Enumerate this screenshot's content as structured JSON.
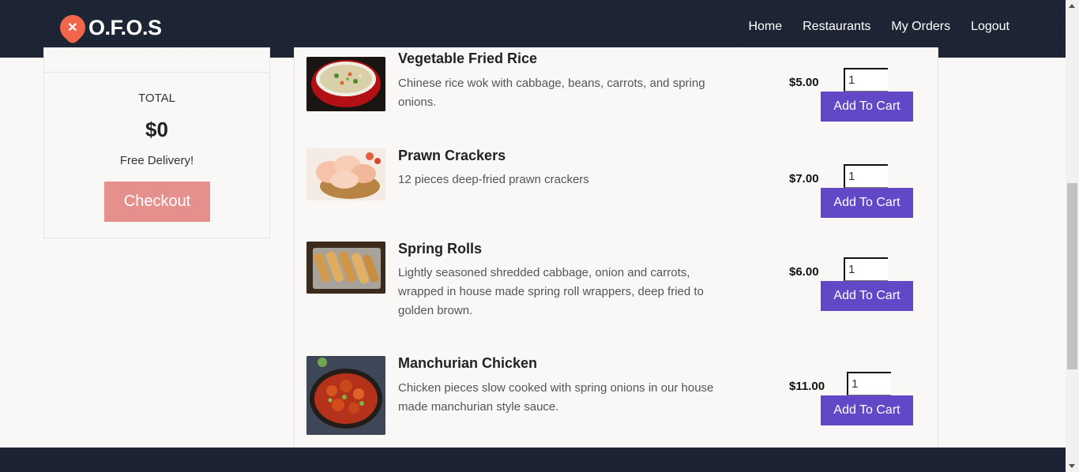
{
  "brand": {
    "name": "O.F.O.S"
  },
  "nav": [
    "Home",
    "Restaurants",
    "My Orders",
    "Logout"
  ],
  "cart": {
    "total_label": "TOTAL",
    "total_amount": "$0",
    "delivery_note": "Free Delivery!",
    "checkout_label": "Checkout"
  },
  "menu": [
    {
      "name": "Vegetable Fried Rice",
      "description": "Chinese rice wok with cabbage, beans, carrots, and spring onions.",
      "price": "$5.00",
      "qty": "1",
      "button": "Add To Cart"
    },
    {
      "name": "Prawn Crackers",
      "description": "12 pieces deep-fried prawn crackers",
      "price": "$7.00",
      "qty": "1",
      "button": "Add To Cart"
    },
    {
      "name": "Spring Rolls",
      "description": "Lightly seasoned shredded cabbage, onion and carrots, wrapped in house made spring roll wrappers, deep fried to golden brown.",
      "price": "$6.00",
      "qty": "1",
      "button": "Add To Cart"
    },
    {
      "name": "Manchurian Chicken",
      "description": "Chicken pieces slow cooked with spring onions in our house made manchurian style sauce.",
      "price": "$11.00",
      "qty": "1",
      "button": "Add To Cart"
    }
  ],
  "colors": {
    "navbar": "#1c2433",
    "accent": "#6248c6",
    "checkout": "#e6908e",
    "logo": "#f1654a"
  },
  "icons": {
    "logo": "fork-knife-pin-icon"
  }
}
